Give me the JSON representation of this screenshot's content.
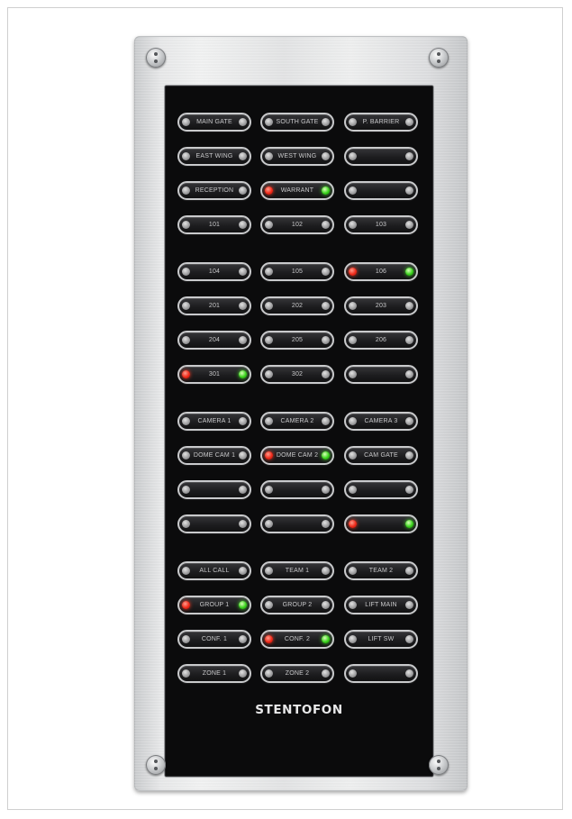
{
  "brand": "STENTOFON",
  "buttons": [
    {
      "label": "MAIN GATE",
      "left_led": "off",
      "right_led": "off"
    },
    {
      "label": "SOUTH GATE",
      "left_led": "off",
      "right_led": "off"
    },
    {
      "label": "P. BARRIER",
      "left_led": "off",
      "right_led": "off"
    },
    {
      "label": "EAST WING",
      "left_led": "off",
      "right_led": "off"
    },
    {
      "label": "WEST WING",
      "left_led": "off",
      "right_led": "off"
    },
    {
      "label": "",
      "left_led": "off",
      "right_led": "off"
    },
    {
      "label": "RECEPTION",
      "left_led": "off",
      "right_led": "off"
    },
    {
      "label": "WARRANT",
      "left_led": "red",
      "right_led": "green"
    },
    {
      "label": "",
      "left_led": "off",
      "right_led": "off"
    },
    {
      "label": "101",
      "left_led": "off",
      "right_led": "off"
    },
    {
      "label": "102",
      "left_led": "off",
      "right_led": "off"
    },
    {
      "label": "103",
      "left_led": "off",
      "right_led": "off"
    },
    {
      "label": "104",
      "left_led": "off",
      "right_led": "off"
    },
    {
      "label": "105",
      "left_led": "off",
      "right_led": "off"
    },
    {
      "label": "106",
      "left_led": "red",
      "right_led": "green"
    },
    {
      "label": "201",
      "left_led": "off",
      "right_led": "off"
    },
    {
      "label": "202",
      "left_led": "off",
      "right_led": "off"
    },
    {
      "label": "203",
      "left_led": "off",
      "right_led": "off"
    },
    {
      "label": "204",
      "left_led": "off",
      "right_led": "off"
    },
    {
      "label": "205",
      "left_led": "off",
      "right_led": "off"
    },
    {
      "label": "206",
      "left_led": "off",
      "right_led": "off"
    },
    {
      "label": "301",
      "left_led": "red",
      "right_led": "green"
    },
    {
      "label": "302",
      "left_led": "off",
      "right_led": "off"
    },
    {
      "label": "",
      "left_led": "off",
      "right_led": "off"
    },
    {
      "label": "CAMERA 1",
      "left_led": "off",
      "right_led": "off"
    },
    {
      "label": "CAMERA 2",
      "left_led": "off",
      "right_led": "off"
    },
    {
      "label": "CAMERA 3",
      "left_led": "off",
      "right_led": "off"
    },
    {
      "label": "DOME CAM 1",
      "left_led": "off",
      "right_led": "off"
    },
    {
      "label": "DOME CAM 2",
      "left_led": "red",
      "right_led": "green"
    },
    {
      "label": "CAM GATE",
      "left_led": "off",
      "right_led": "off"
    },
    {
      "label": "",
      "left_led": "off",
      "right_led": "off"
    },
    {
      "label": "",
      "left_led": "off",
      "right_led": "off"
    },
    {
      "label": "",
      "left_led": "off",
      "right_led": "off"
    },
    {
      "label": "",
      "left_led": "off",
      "right_led": "off"
    },
    {
      "label": "",
      "left_led": "off",
      "right_led": "off"
    },
    {
      "label": "",
      "left_led": "red",
      "right_led": "green"
    },
    {
      "label": "ALL CALL",
      "left_led": "off",
      "right_led": "off"
    },
    {
      "label": "TEAM 1",
      "left_led": "off",
      "right_led": "off"
    },
    {
      "label": "TEAM 2",
      "left_led": "off",
      "right_led": "off"
    },
    {
      "label": "GROUP 1",
      "left_led": "red",
      "right_led": "green"
    },
    {
      "label": "GROUP 2",
      "left_led": "off",
      "right_led": "off"
    },
    {
      "label": "LIFT MAIN",
      "left_led": "off",
      "right_led": "off"
    },
    {
      "label": "CONF. 1",
      "left_led": "off",
      "right_led": "off"
    },
    {
      "label": "CONF. 2",
      "left_led": "red",
      "right_led": "green"
    },
    {
      "label": "LIFT SW",
      "left_led": "off",
      "right_led": "off"
    },
    {
      "label": "ZONE 1",
      "left_led": "off",
      "right_led": "off"
    },
    {
      "label": "ZONE 2",
      "left_led": "off",
      "right_led": "off"
    },
    {
      "label": "",
      "left_led": "off",
      "right_led": "off"
    }
  ]
}
